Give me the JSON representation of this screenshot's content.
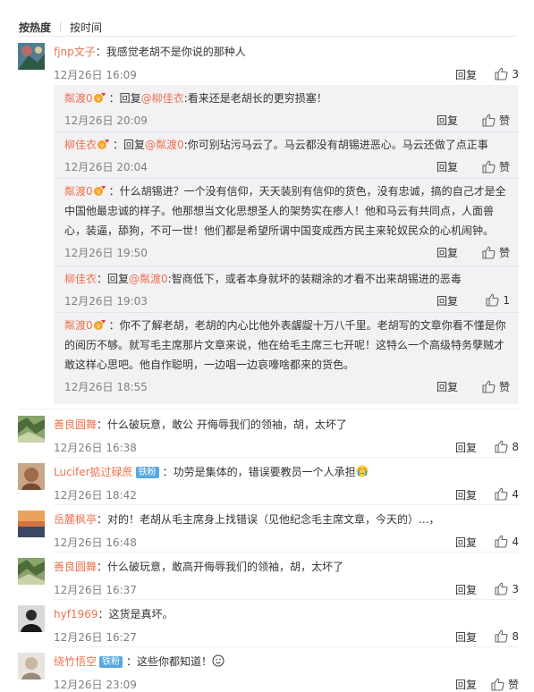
{
  "sort": {
    "hot": "按热度",
    "time": "按时间"
  },
  "reply_label": "回复",
  "like_label": "赞",
  "comments": [
    {
      "user": "fjnp文子",
      "text": "：我感觉老胡不是你说的那种人",
      "date": "12月26日 16:09",
      "likes": "3"
    },
    {
      "user": "善良圆舞",
      "text": "：什么破玩意，敢公 开侮辱我们的领袖，胡，太坏了",
      "date": "12月26日 16:38",
      "likes": "8"
    },
    {
      "user": "Lucifer掂过碌蔗",
      "badge": "铁粉",
      "text": "：功劳是集体的，错误要教员一个人承担",
      "date": "12月26日 18:42",
      "likes": "4"
    },
    {
      "user": "岳麓枫亭",
      "text": "：对的！老胡从毛主席身上找错误（见他纪念毛主席文章，今天的）...，",
      "date": "12月26日 16:48",
      "likes": "4"
    },
    {
      "user": "善良圆舞",
      "text": "：什么破玩意，敢高开侮辱我们的领袖，胡，太坏了",
      "date": "12月26日 16:37",
      "likes": "3"
    },
    {
      "user": "hyf1969",
      "text": "：这货是真坏。",
      "date": "12月26日 16:27",
      "likes": "8"
    },
    {
      "user": "绕竹悟空",
      "badge": "铁粉",
      "text": "：这些你都知道！",
      "date": "12月26日 23:09",
      "likes": "赞"
    }
  ],
  "replies": [
    {
      "user": "粼渡0",
      "prefix": "：回复",
      "mention": "@柳佳衣",
      "text": ":看来还是老胡长的更穷损塞！",
      "date": "12月26日 20:09",
      "likes": "赞"
    },
    {
      "user": "柳佳衣",
      "prefix": "：回复",
      "mention": "@粼渡0",
      "text": ":你可别玷污马云了。马云都没有胡锡进恶心。马云还做了点正事",
      "date": "12月26日 20:04",
      "likes": "赞"
    },
    {
      "user": "粼渡0",
      "prefix": "",
      "mention": "",
      "text": "：什么胡锡进？一个没有信仰，天天装别有信仰的货色，没有忠诚，搞的自己才是全中国他最忠诚的样子。他那想当文化思想圣人的架势实在瘆人！他和马云有共同点，人面兽心，装逼，舔狗，不可一世！他们都是希望所谓中国变成西方民主来轮奴民众的心机闹钟。",
      "date": "12月26日 19:50",
      "likes": "赞"
    },
    {
      "user": "柳佳衣",
      "prefix": "：回复",
      "mention": "@粼渡0",
      "text": ":智商低下，或者本身就坏的装糊涂的才看不出来胡锡进的恶毒",
      "date": "12月26日 19:03",
      "likes": "1"
    },
    {
      "user": "粼渡0",
      "prefix": "",
      "mention": "",
      "text": "：你不了解老胡，老胡的内心比他外表龌龊十万八千里。老胡写的文章你看不懂是你的阅历不够。就写毛主席那片文章来说，他在给毛主席三七开呢！这特么一个高级特务孽贼才敢这样心思吧。他自作聪明，一边唱一边哀嚎啥都来的货色。",
      "date": "12月26日 18:55",
      "likes": "赞"
    }
  ],
  "colors": {
    "username": "#eb7350",
    "badge": "#57a8e0",
    "subbox": "#f2f2f5",
    "date": "#808080"
  }
}
